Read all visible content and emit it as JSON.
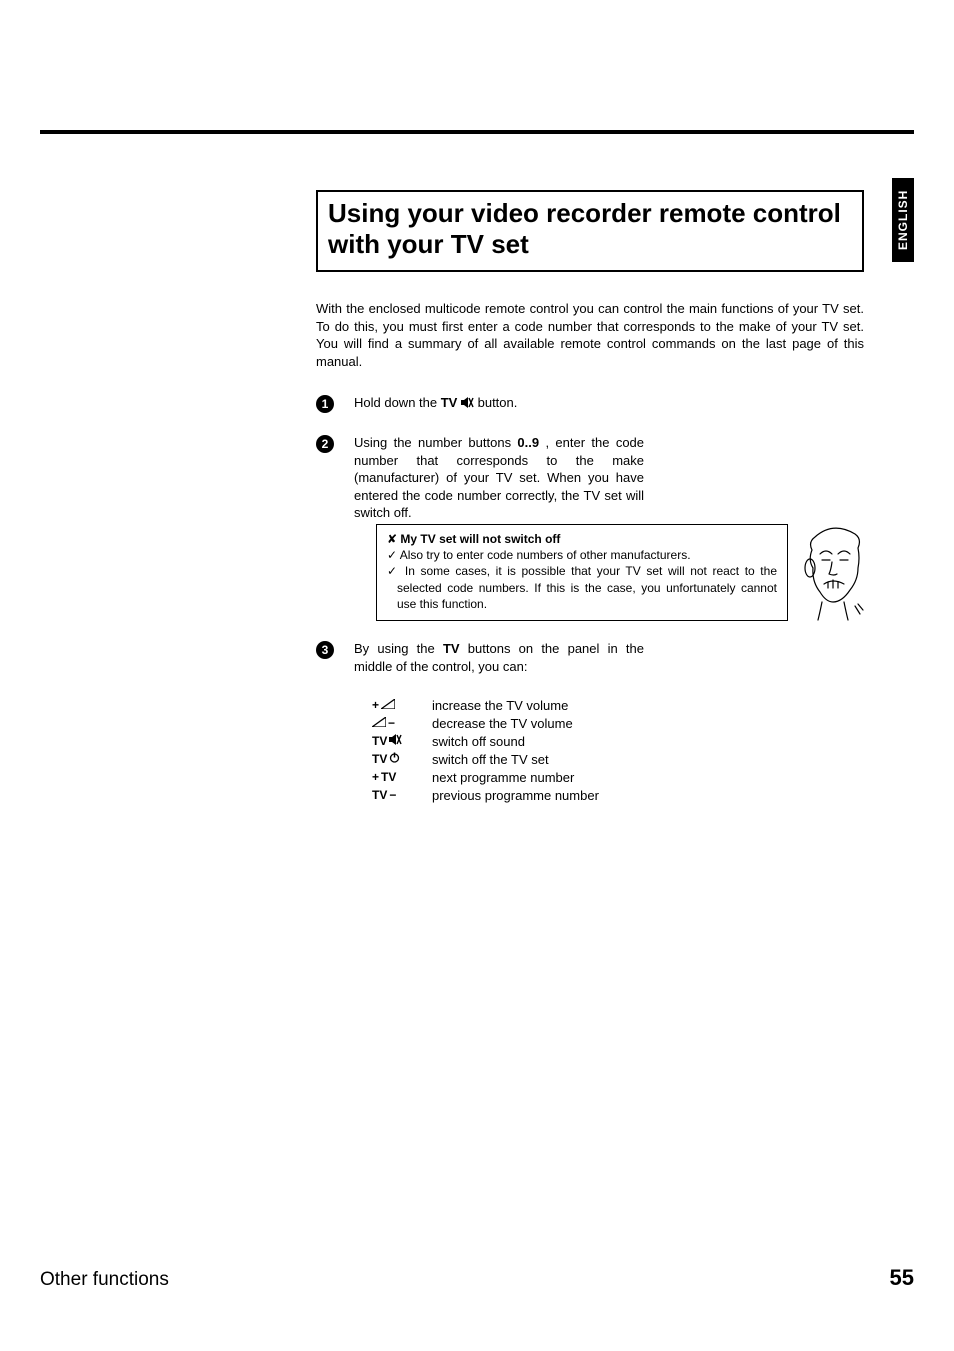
{
  "language_tab": "ENGLISH",
  "title": "Using your video recorder remote control with your TV set",
  "intro": "With the enclosed multicode remote control you can control the main functions of your TV set. To do this, you must first enter a code number that corresponds to the make of your TV set. You will find a summary of all available remote control commands on the last page of this manual.",
  "steps": {
    "s1": {
      "num": "1",
      "pre": "Hold down the ",
      "bold": "TV",
      "post": " button."
    },
    "s2": {
      "num": "2",
      "pre": "Using the number buttons ",
      "bold": "0..9",
      "post": " , enter the code number that corresponds to the make (manufacturer) of your TV set.",
      "line2": "When you have entered the code number correctly, the TV set will switch off."
    },
    "s3": {
      "num": "3",
      "pre": "By using the ",
      "bold": "TV",
      "post": " buttons on the panel in the middle of the control, you can:"
    }
  },
  "tip": {
    "title": "My TV set will not switch off",
    "line1": "Also try to enter code numbers of other manufacturers.",
    "line2": "In some cases, it is possible that your TV set will not react to the selected code numbers. If this is the case, you unfortunately cannot use this function."
  },
  "functions": [
    {
      "key_pre": "+",
      "key_bold": "",
      "icon": "vol",
      "desc": "increase the TV volume"
    },
    {
      "key_pre": "",
      "key_bold": "",
      "icon": "vol",
      "key_post": "−",
      "desc": "decrease the TV volume"
    },
    {
      "key_pre": "",
      "key_bold": "TV",
      "icon": "mute",
      "desc": "switch off sound"
    },
    {
      "key_pre": "",
      "key_bold": "TV",
      "icon": "power",
      "desc": "switch off the TV set"
    },
    {
      "key_pre": "+ ",
      "key_bold": "TV",
      "icon": "",
      "desc": "next programme number"
    },
    {
      "key_pre": "",
      "key_bold": "TV",
      "key_post": " −",
      "icon": "",
      "desc": "previous programme number"
    }
  ],
  "footer": {
    "left": "Other functions",
    "right": "55"
  }
}
